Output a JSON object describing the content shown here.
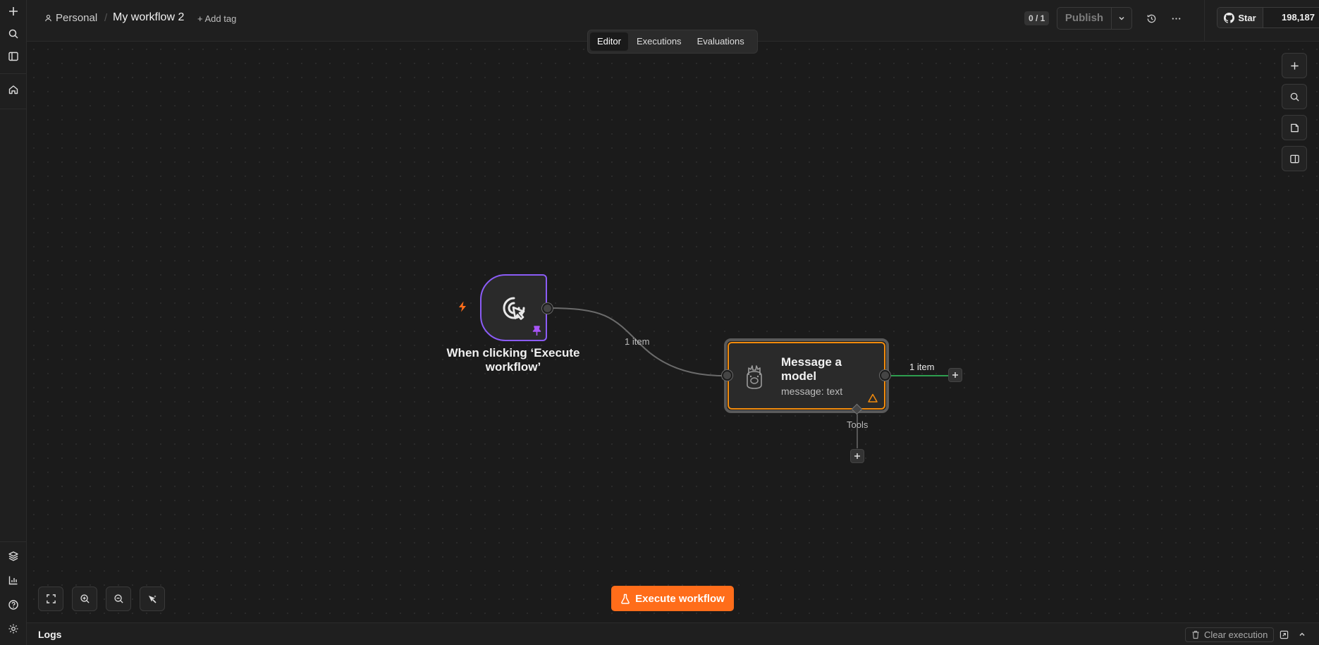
{
  "header": {
    "project": "Personal",
    "workflow_name": "My workflow 2",
    "add_tag": "+ Add tag",
    "counter": "0 / 1",
    "publish_label": "Publish",
    "github_star": "Star",
    "github_count": "198,187"
  },
  "tabs": [
    {
      "label": "Editor",
      "active": true
    },
    {
      "label": "Executions",
      "active": false
    },
    {
      "label": "Evaluations",
      "active": false
    }
  ],
  "nodes": {
    "trigger": {
      "label": "When clicking ‘Execute workflow’",
      "icon": "cursor-click-icon",
      "accent": "#8b5cf6"
    },
    "model": {
      "title": "Message a model",
      "subtitle": "message: text",
      "icon": "llama-icon",
      "accent": "#f28b0c"
    }
  },
  "edges": {
    "trigger_to_model": "1 item",
    "model_output": "1 item",
    "tools_label": "Tools"
  },
  "canvas_controls": [
    "fit-view-icon",
    "zoom-in-icon",
    "zoom-out-icon",
    "tidy-up-icon"
  ],
  "execute_button": "Execute workflow",
  "logs": {
    "title": "Logs",
    "clear_label": "Clear execution"
  },
  "colors": {
    "accent": "#ff6d1a",
    "success_edge": "#2e9e4f"
  }
}
